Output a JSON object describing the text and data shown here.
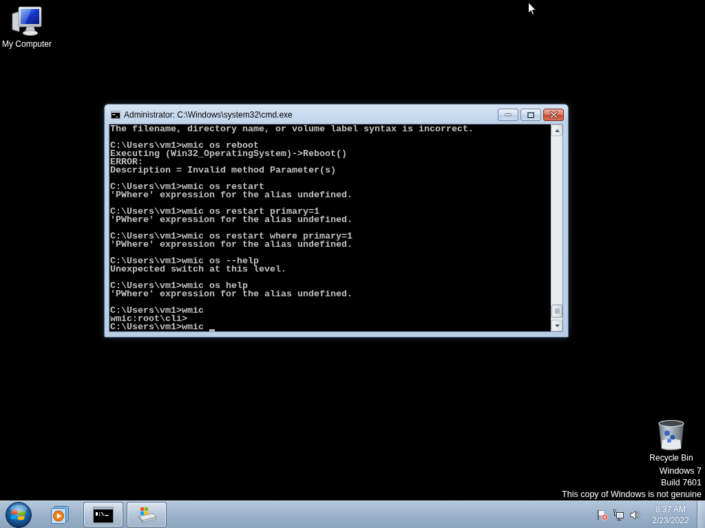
{
  "desktop": {
    "icons": [
      {
        "kind": "computer",
        "label": "My Computer"
      },
      {
        "kind": "recycle-bin",
        "label": "Recycle Bin"
      }
    ],
    "notice_lines": [
      "Windows 7",
      "Build 7601",
      "This copy of Windows is not genuine"
    ]
  },
  "window": {
    "title": "Administrator: C:\\Windows\\system32\\cmd.exe",
    "console": {
      "blocks": [
        [
          "The filename, directory name, or volume label syntax is incorrect."
        ],
        [
          "C:\\Users\\vm1>wmic os reboot",
          "Executing (Win32_OperatingSystem)->Reboot()",
          "ERROR:",
          "Description = Invalid method Parameter(s)"
        ],
        [
          "C:\\Users\\vm1>wmic os restart",
          "'PWhere' expression for the alias undefined."
        ],
        [
          "C:\\Users\\vm1>wmic os restart primary=1",
          "'PWhere' expression for the alias undefined."
        ],
        [
          "C:\\Users\\vm1>wmic os restart where primary=1",
          "'PWhere' expression for the alias undefined."
        ],
        [
          "C:\\Users\\vm1>wmic os --help",
          "Unexpected switch at this level."
        ],
        [
          "C:\\Users\\vm1>wmic os help",
          "'PWhere' expression for the alias undefined."
        ],
        [
          "C:\\Users\\vm1>wmic",
          "wmic:root\\cli>",
          "C:\\Users\\vm1>wmic"
        ]
      ],
      "cursor_visible": true
    }
  },
  "taskbar": {
    "items": [
      {
        "kind": "media-player",
        "running": false
      },
      {
        "kind": "console",
        "running": true
      },
      {
        "kind": "file-transfer",
        "running": true
      }
    ],
    "tray": {
      "time": "8:37 AM",
      "date": "2/23/2022"
    }
  }
}
